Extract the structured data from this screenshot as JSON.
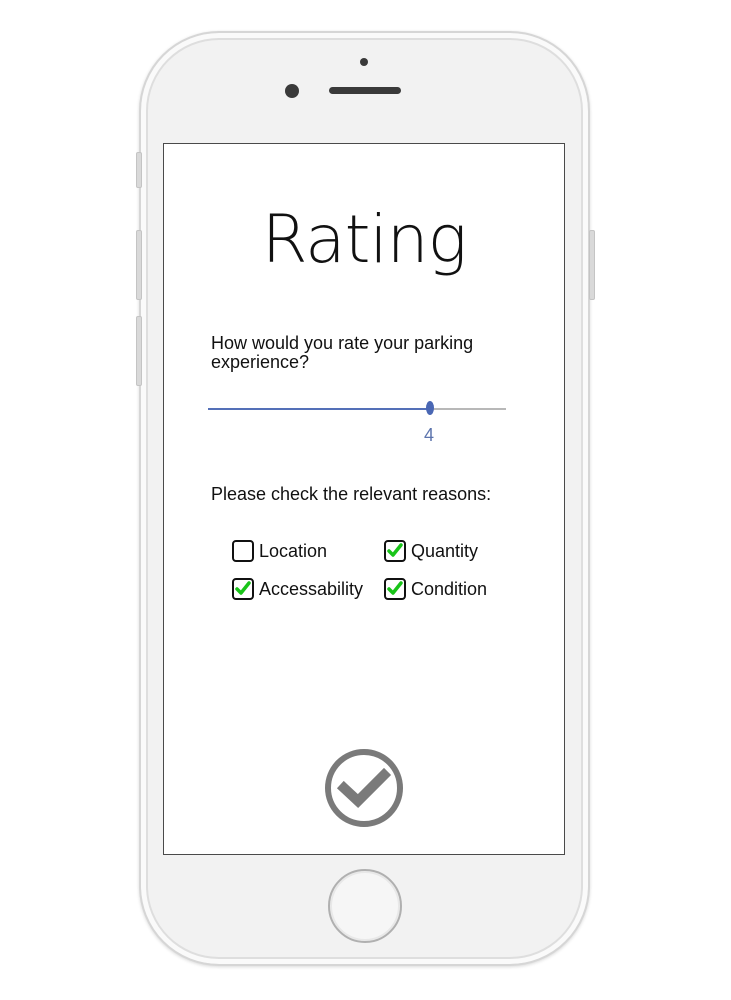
{
  "screen": {
    "title": "Rating",
    "question": "How would you rate your parking experience?",
    "slider": {
      "min": 0,
      "max": 5,
      "value": 4,
      "value_label": "4"
    },
    "reasons_label": "Please check the relevant reasons:",
    "reasons": [
      {
        "label": "Location",
        "checked": false
      },
      {
        "label": "Quantity",
        "checked": true
      },
      {
        "label": "Accessability",
        "checked": true
      },
      {
        "label": "Condition",
        "checked": true
      }
    ],
    "submit_icon": "checkmark-circle-icon"
  },
  "colors": {
    "slider_fill": "#5470b8",
    "slider_track": "#b8b8b8",
    "check_green": "#19c419",
    "submit_gray": "#7a7a7a"
  }
}
